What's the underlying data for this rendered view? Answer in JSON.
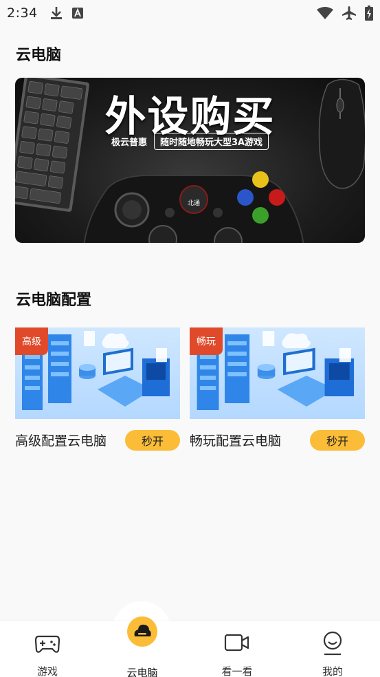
{
  "status_bar": {
    "time": "2:34",
    "left_icons": [
      "download-icon",
      "a-icon"
    ],
    "right_icons": [
      "wifi-icon",
      "airplane-icon",
      "battery-icon"
    ]
  },
  "section1": {
    "title": "云电脑"
  },
  "banner": {
    "title": "外设购买",
    "brand": "极云普惠",
    "pill": "随时随地畅玩大型3A游戏"
  },
  "section2": {
    "title": "云电脑配置"
  },
  "cards": [
    {
      "tag": "高级",
      "name": "高级配置云电脑",
      "button": "秒开"
    },
    {
      "tag": "畅玩",
      "name": "畅玩配置云电脑",
      "button": "秒开"
    }
  ],
  "nav": {
    "items": [
      {
        "label": "游戏",
        "icon": "gamepad-icon"
      },
      {
        "label": "云电脑",
        "icon": "cloud-pc-icon"
      },
      {
        "label": "看一看",
        "icon": "video-icon"
      },
      {
        "label": "我的",
        "icon": "profile-icon"
      }
    ],
    "active": "云电脑"
  },
  "colors": {
    "accent": "#fbbd37",
    "tag": "#e04a2b"
  }
}
